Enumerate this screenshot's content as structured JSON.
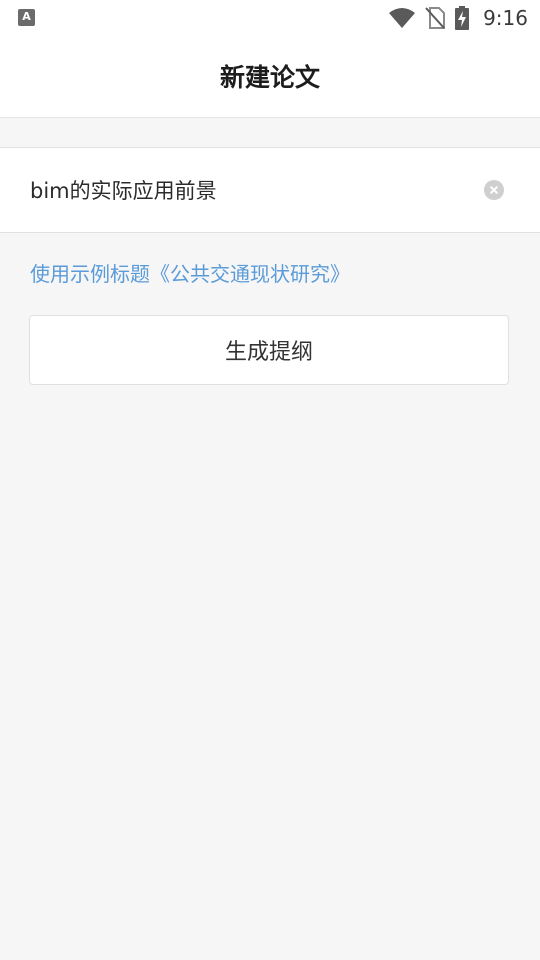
{
  "status_bar": {
    "notification_icon_letter": "A",
    "time": "9:16",
    "icons": [
      "wifi-icon",
      "no-sim-icon",
      "battery-charging-icon"
    ]
  },
  "header": {
    "title": "新建论文"
  },
  "title_input": {
    "value": "bim的实际应用前景",
    "placeholder": ""
  },
  "example_link": {
    "label": "使用示例标题《公共交通现状研究》"
  },
  "generate_button": {
    "label": "生成提纲"
  },
  "colors": {
    "accent_link": "#5b9bd8",
    "background": "#f6f6f6",
    "surface": "#ffffff",
    "text_primary": "#1d1d1d"
  }
}
